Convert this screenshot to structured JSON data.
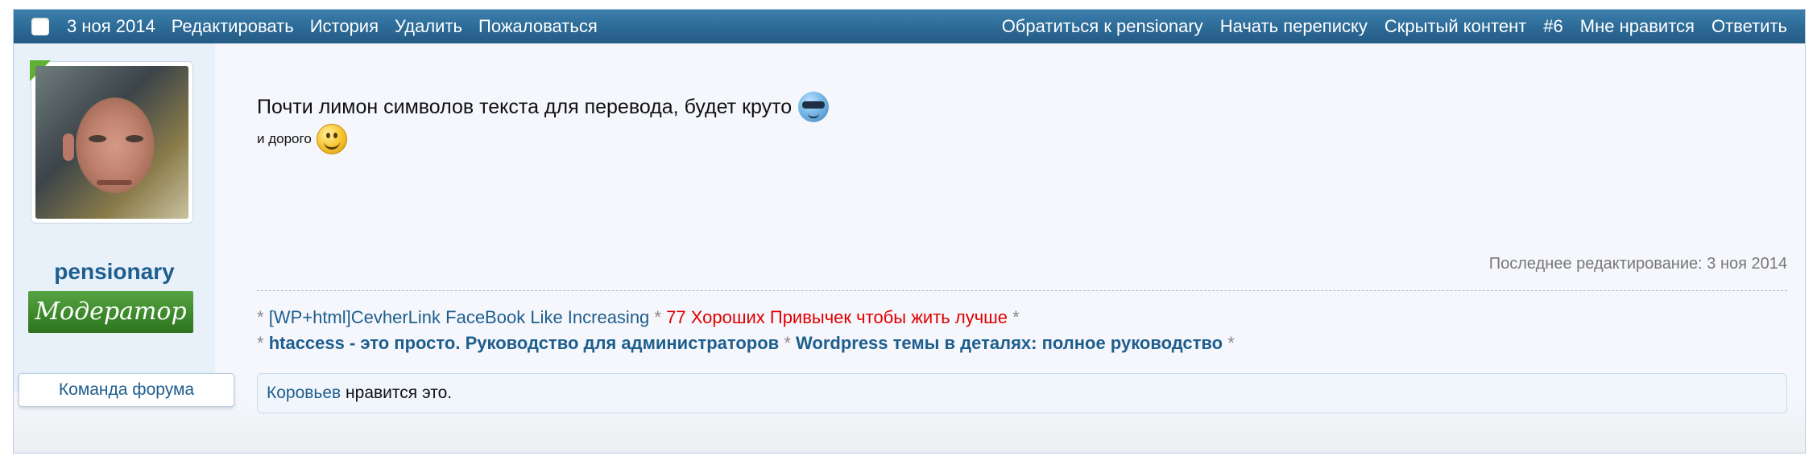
{
  "topbar": {
    "date": "3 ноя 2014",
    "edit": "Редактировать",
    "history": "История",
    "delete": "Удалить",
    "report": "Пожаловаться",
    "contact": "Обратиться к pensionary",
    "start_conversation": "Начать переписку",
    "hidden_content": "Скрытый контент",
    "post_number": "#6",
    "like": "Мне нравится",
    "reply": "Ответить"
  },
  "user": {
    "name": "pensionary",
    "rank": "Модератор",
    "team": "Команда форума"
  },
  "message": {
    "line1": "Почти лимон символов текста для перевода, будет круто",
    "line2": "и дорого"
  },
  "edited": "Последнее редактирование: 3 ноя 2014",
  "signature": {
    "link1": "[WP+html]CevherLink FaceBook Like Increasing",
    "link2": "77 Хороших Привычек чтобы жить лучше",
    "link3": "htaccess - это просто. Руководство для администраторов",
    "link4": "Wordpress темы в деталях: полное руководство",
    "separator": "*"
  },
  "likes": {
    "user": "Коровьев",
    "text": "нравится это."
  },
  "colors": {
    "topbar": "#2c6a96",
    "username": "#1e5e8e",
    "rank_badge": "#3d8a2c",
    "red_link": "#e00000"
  }
}
